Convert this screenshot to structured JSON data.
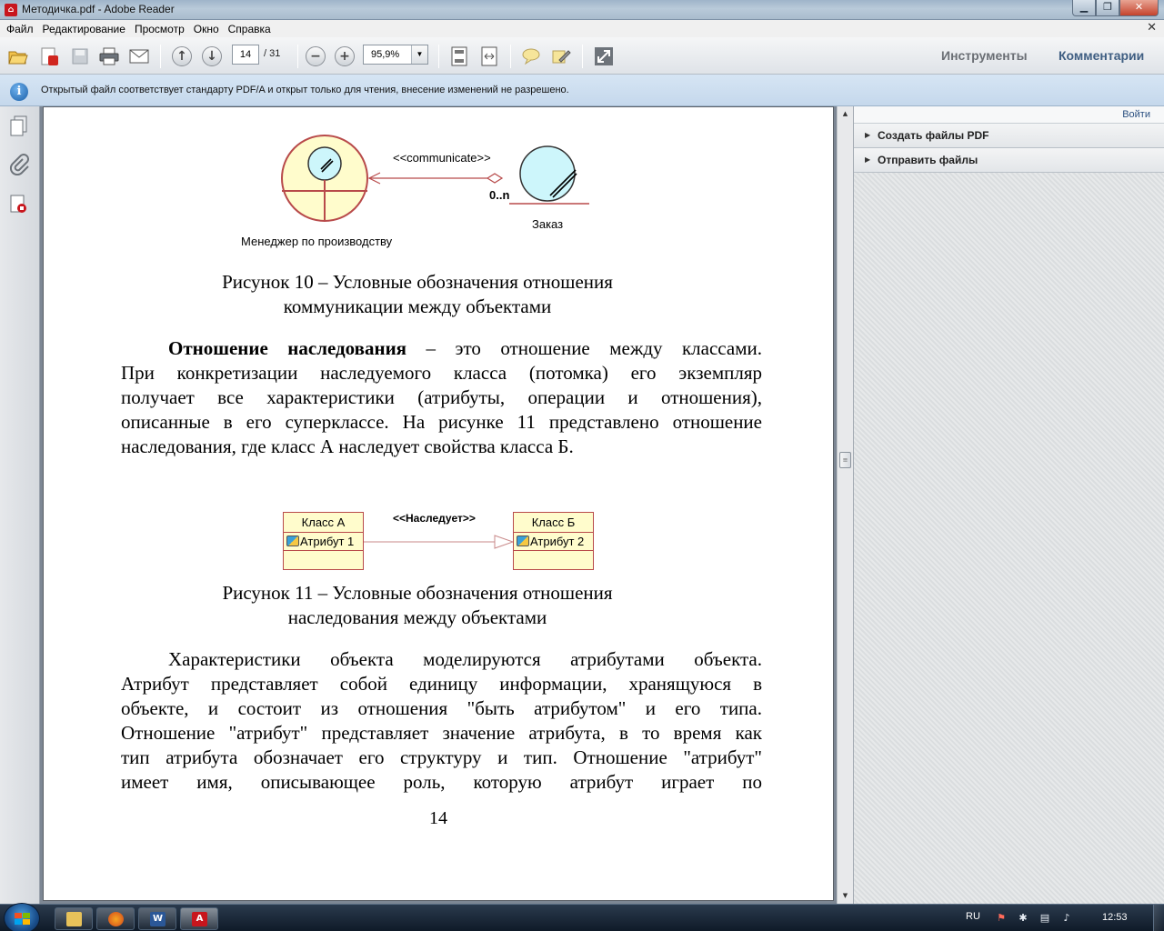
{
  "window": {
    "title": "Методичка.pdf - Adobe Reader",
    "app_icon": "pdf-icon"
  },
  "menu": [
    "Файл",
    "Редактирование",
    "Просмотр",
    "Окно",
    "Справка"
  ],
  "toolbar": {
    "current_page": "14",
    "page_total": "/ 31",
    "zoom": "95,9%",
    "tools_label": "Инструменты",
    "comments_label": "Комментарии"
  },
  "infobar": {
    "message": "Открытый файл соответствует стандарту PDF/A и открыт только для чтения, внесение изменений не разрешено."
  },
  "right_panel": {
    "login": "Войти",
    "items": [
      "Создать файлы PDF",
      "Отправить файлы"
    ]
  },
  "document": {
    "figure10": {
      "stereotype": "<<communicate>>",
      "multiplicity": "0..n",
      "actor_label": "Менеджер по производству",
      "entity_label": "Заказ",
      "caption_line1": "Рисунок 10 – Условные обозначения отношения",
      "caption_line2": "коммуникации между объектами"
    },
    "paragraph1": {
      "bold_term": "Отношение наследования",
      "line1_rest": " – это отношение между классами.",
      "line2": "При конкретизации наследуемого класса (потомка) его экземпляр",
      "line3": "получает все характеристики (атрибуты, операции и отношения),",
      "line4": "описанные в его суперклассе. На рисунке 11 представлено отношение",
      "line5": "наследования, где класс А наследует свойства класса Б."
    },
    "figure11": {
      "stereotype": "<<Наследует>>",
      "class_a_name": "Класс А",
      "class_a_attr": "Атрибут 1",
      "class_b_name": "Класс Б",
      "class_b_attr": "Атрибут 2",
      "caption_line1": "Рисунок 11 – Условные обозначения отношения",
      "caption_line2": "наследования между объектами"
    },
    "paragraph2": {
      "line1": "Характеристики объекта моделируются атрибутами объекта.",
      "line2": "Атрибут представляет собой единицу информации, хранящуюся в",
      "line3": "объекте, и состоит из отношения \"быть атрибутом\" и его типа.",
      "line4": "Отношение \"атрибут\" представляет значение атрибута, в то время как",
      "line5": "тип атрибута обозначает его структуру и тип. Отношение \"атрибут\"",
      "line6": "имеет имя, описывающее роль, которую атрибут играет по"
    },
    "page_number": "14"
  },
  "taskbar": {
    "language": "RU",
    "time": "12:53"
  }
}
